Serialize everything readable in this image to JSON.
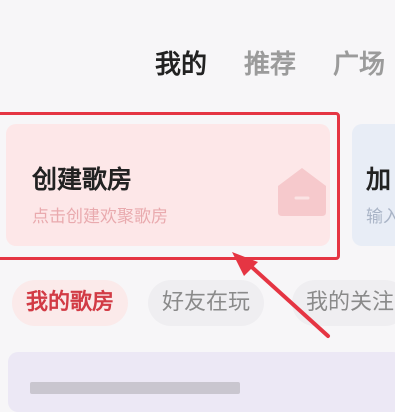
{
  "tabs": [
    {
      "label": "我的",
      "active": true
    },
    {
      "label": "推荐",
      "active": false
    },
    {
      "label": "广场",
      "active": false
    }
  ],
  "create_card": {
    "title": "创建歌房",
    "subtitle": "点击创建欢聚歌房"
  },
  "join_card": {
    "title": "加",
    "subtitle": "输入"
  },
  "filters": [
    {
      "label": "我的歌房",
      "active": true
    },
    {
      "label": "好友在玩",
      "active": false
    },
    {
      "label": "我的关注",
      "active": false
    }
  ],
  "colors": {
    "accent_red": "#e53543",
    "card_pink": "#fde7e8",
    "card_blue": "#e8edf6"
  },
  "icons": {
    "create_card_icon": "house-icon"
  }
}
